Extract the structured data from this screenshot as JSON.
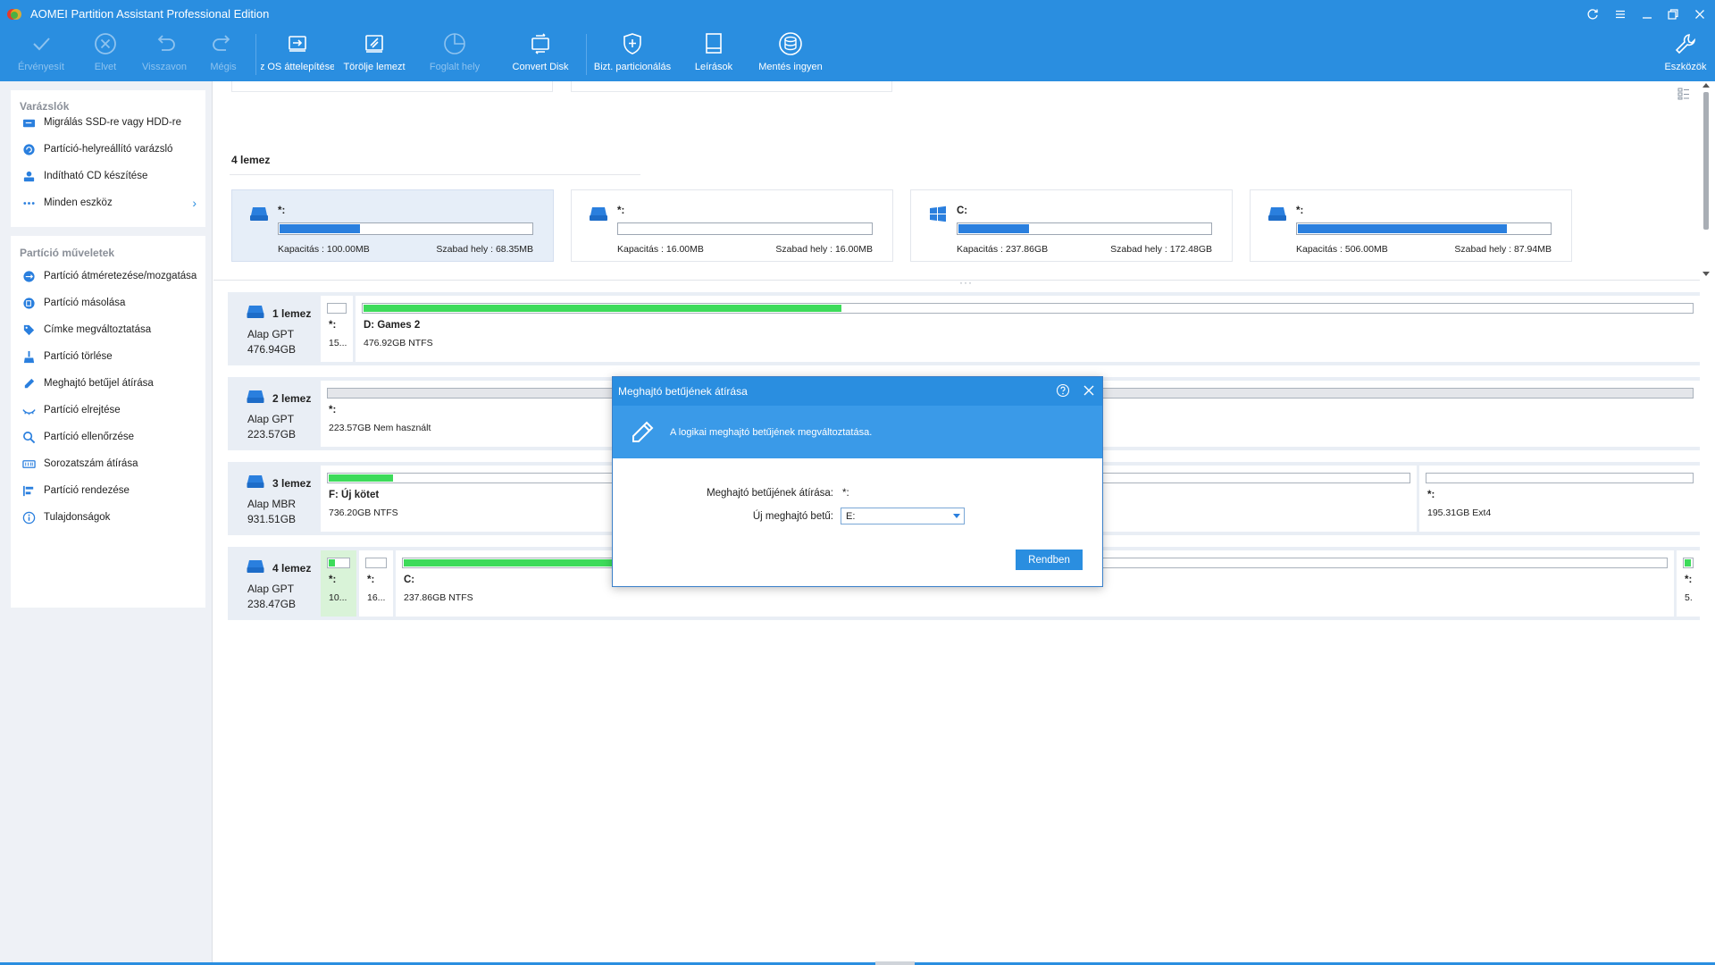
{
  "app": {
    "title": "AOMEI Partition Assistant Professional Edition"
  },
  "toolbar": {
    "apply": "Érvényesít",
    "discard": "Elvet",
    "undo": "Visszavon",
    "redo": "Mégis",
    "os_migrate": "z OS áttelepítése",
    "wipe_disk": "Törölje  lemezt",
    "allocate_space": "Foglalt hely",
    "convert_disk": "Convert Disk",
    "secure_partition": "Bizt. particionálás",
    "tutorials": "Leírások",
    "free_backup": "Mentés ingyen",
    "tools": "Eszközök"
  },
  "sidebar": {
    "wizards_title": "Varázslók",
    "wizards": [
      {
        "label": "Migrálás SSD-re vagy HDD-re",
        "icon": "disk-migrate-icon"
      },
      {
        "label": "Partíció-helyreállító varázsló",
        "icon": "recovery-icon"
      },
      {
        "label": "Indítható CD készítése",
        "icon": "bootable-cd-icon"
      },
      {
        "label": "Minden eszköz",
        "icon": "more-dots-icon"
      }
    ],
    "operations_title": "Partíció műveletek",
    "operations": [
      {
        "label": "Partíció átméretezése/mozgatása",
        "icon": "resize-icon"
      },
      {
        "label": "Partíció másolása",
        "icon": "copy-icon"
      },
      {
        "label": "Címke megváltoztatása",
        "icon": "label-tag-icon"
      },
      {
        "label": "Partíció törlése",
        "icon": "delete-broom-icon"
      },
      {
        "label": "Meghajtó betűjel átírása",
        "icon": "pencil-icon"
      },
      {
        "label": "Partíció elrejtése",
        "icon": "hide-eye-icon"
      },
      {
        "label": "Partíció ellenőrzése",
        "icon": "check-magnifier-icon"
      },
      {
        "label": "Sorozatszám átírása",
        "icon": "serial-number-icon"
      },
      {
        "label": "Partíció rendezése",
        "icon": "align-icon"
      },
      {
        "label": "Tulajdonságok",
        "icon": "info-icon"
      }
    ]
  },
  "partition_view": {
    "disk_title": "4 lemez",
    "cards": [
      {
        "name": "*:",
        "capacity": "Kapacitás : 100.00MB",
        "free": "Szabad hely : 68.35MB",
        "used_fraction": 0.32,
        "icon": "drive-icon"
      },
      {
        "name": "*:",
        "capacity": "Kapacitás : 16.00MB",
        "free": "Szabad hely : 16.00MB",
        "used_fraction": 0.0,
        "icon": "drive-icon"
      },
      {
        "name": "C:",
        "capacity": "Kapacitás : 237.86GB",
        "free": "Szabad hely : 172.48GB",
        "used_fraction": 0.28,
        "icon": "windows-icon"
      },
      {
        "name": "*:",
        "capacity": "Kapacitás : 506.00MB",
        "free": "Szabad hely : 87.94MB",
        "used_fraction": 0.83,
        "icon": "drive-icon"
      }
    ]
  },
  "disks": [
    {
      "name": "1 lemez",
      "type": "Alap GPT",
      "size": "476.94GB",
      "partitions": [
        {
          "label": "*:",
          "desc": "15...",
          "used_fraction": 0.0
        },
        {
          "label": "D: Games 2",
          "desc": "476.92GB NTFS",
          "used_fraction": 0.36
        }
      ]
    },
    {
      "name": "2 lemez",
      "type": "Alap GPT",
      "size": "223.57GB",
      "partitions": [
        {
          "label": "*:",
          "desc": "223.57GB Nem használt",
          "used_fraction": 0.0
        }
      ]
    },
    {
      "name": "3 lemez",
      "type": "Alap MBR",
      "size": "931.51GB",
      "partitions": [
        {
          "label": "F: Új kötet",
          "desc": "736.20GB NTFS",
          "used_fraction": 0.16
        },
        {
          "label": "",
          "desc": "",
          "used_fraction": 0.0
        },
        {
          "label": "*:",
          "desc": "195.31GB Ext4",
          "used_fraction": 0.0
        }
      ]
    },
    {
      "name": "4 lemez",
      "type": "Alap GPT",
      "size": "238.47GB",
      "partitions": [
        {
          "label": "*:",
          "desc": "10...",
          "used_fraction": 0.32
        },
        {
          "label": "*:",
          "desc": "16...",
          "used_fraction": 0.0
        },
        {
          "label": "C:",
          "desc": "237.86GB NTFS",
          "used_fraction": 0.28
        },
        {
          "label": "*:",
          "desc": "5.",
          "used_fraction": 0.83
        }
      ]
    }
  ],
  "dialog": {
    "title": "Meghajtó betűjének átírása",
    "banner_text": "A logikai meghajtó betűjének megváltoztatása.",
    "current_label": "Meghajtó betűjének átírása:",
    "current_value": "*:",
    "new_label": "Új meghajtó betű:",
    "new_value": "E:",
    "ok": "Rendben"
  },
  "colors": {
    "accent": "#2a8ee0",
    "used_bar": "#3ddb5a",
    "card_bar": "#2a7fde",
    "sidebar_bg": "#eef1f6",
    "row_bg": "#e9eef5"
  }
}
